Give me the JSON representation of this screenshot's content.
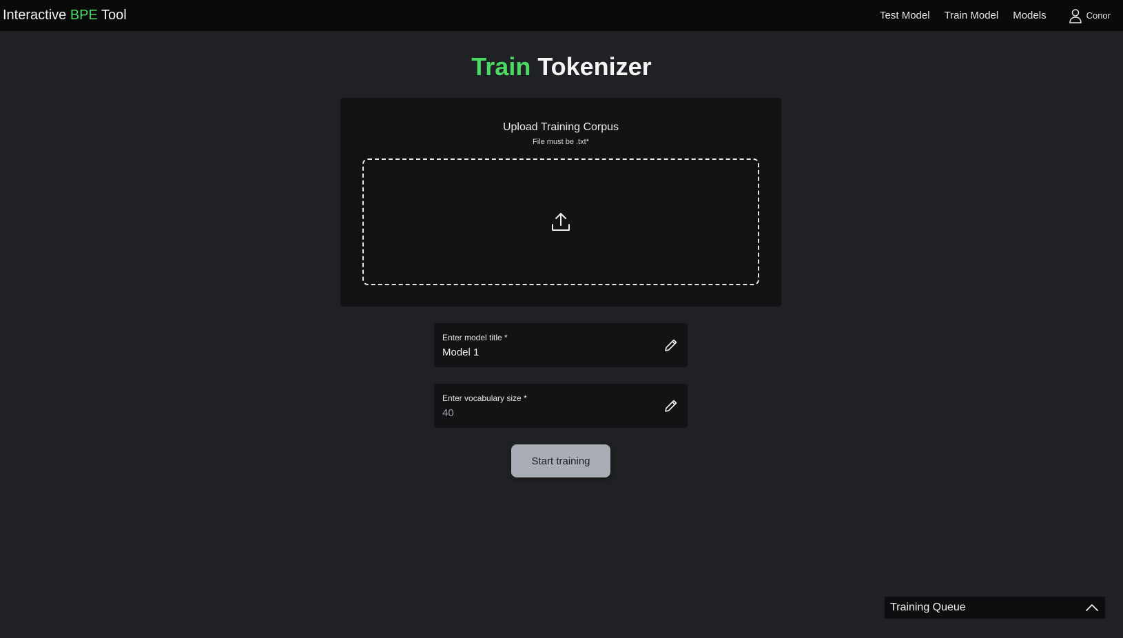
{
  "header": {
    "brand_prefix": "Interactive ",
    "brand_accent": "BPE",
    "brand_suffix": " Tool",
    "nav": [
      "Test Model",
      "Train Model",
      "Models"
    ],
    "user_name": "Conor",
    "user_icon": "user-icon"
  },
  "main": {
    "title_accent": "Train",
    "title_rest": " Tokenizer",
    "upload": {
      "title": "Upload Training Corpus",
      "subtitle": "File must be .txt*",
      "icon": "upload-icon"
    },
    "model_title_field": {
      "label": "Enter model title *",
      "value": "Model 1",
      "icon": "pencil-icon"
    },
    "vocab_field": {
      "label": "Enter vocabulary size *",
      "placeholder": "40",
      "icon": "pencil-icon"
    },
    "start_button": "Start training"
  },
  "queue": {
    "title": "Training Queue",
    "icon": "chevron-up-icon"
  },
  "colors": {
    "accent": "#4cd964",
    "background": "#202124",
    "navbar": "#0a0a0a",
    "card": "#131315",
    "button": "#a9adb6"
  }
}
